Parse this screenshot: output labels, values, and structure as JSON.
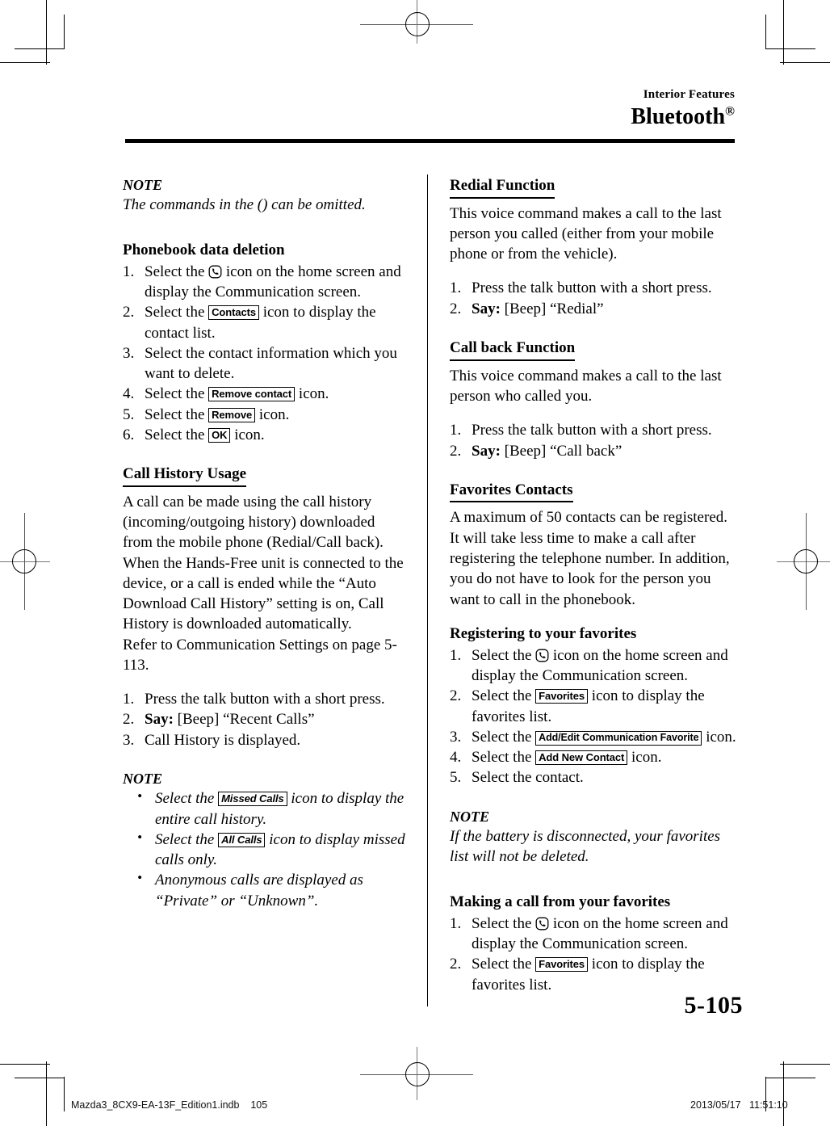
{
  "header": {
    "kicker": "Interior Features",
    "title": "Bluetooth",
    "registered_mark": "®"
  },
  "page_number": "5-105",
  "footer": {
    "file": "Mazda3_8CX9-EA-13F_Edition1.indb    105",
    "timestamp": "2013/05/17   11:51:10"
  },
  "icons": {
    "communication": "phone-communication-icon"
  },
  "left_column": {
    "note_1": {
      "label": "NOTE",
      "text": "The commands in the () can be omitted."
    },
    "phonebook_deletion": {
      "heading": "Phonebook data deletion",
      "steps": [
        {
          "num": "1.",
          "pre": "Select the ",
          "icon": "communication",
          "post": " icon on the home screen and display the Communication screen."
        },
        {
          "num": "2.",
          "pre": "Select the ",
          "button": "Contacts",
          "post": " icon to display the contact list."
        },
        {
          "num": "3.",
          "pre": "Select the contact information which you want to delete.",
          "post": ""
        },
        {
          "num": "4.",
          "pre": "Select the ",
          "button": "Remove contact",
          "post": " icon."
        },
        {
          "num": "5.",
          "pre": "Select the ",
          "button": "Remove",
          "post": " icon."
        },
        {
          "num": "6.",
          "pre": "Select the ",
          "button": "OK",
          "post": " icon."
        }
      ]
    },
    "call_history": {
      "heading": "Call History Usage",
      "paragraph": "A call can be made using the call history (incoming/outgoing history) downloaded from the mobile phone (Redial/Call back). When the Hands-Free unit is connected to the device, or a call is ended while the “Auto Download Call History” setting is on, Call History is downloaded automatically.",
      "paragraph_2": "Refer to Communication Settings on page 5-113.",
      "steps": [
        {
          "num": "1.",
          "text": "Press the talk button with a short press."
        },
        {
          "num": "2.",
          "say": "Say:",
          "text": " [Beep] “Recent Calls”"
        },
        {
          "num": "3.",
          "text": "Call History is displayed."
        }
      ]
    },
    "note_2": {
      "label": "NOTE",
      "bullets": [
        {
          "pre": "Select the ",
          "button": "Missed Calls",
          "post": " icon to display the entire call history."
        },
        {
          "pre": "Select the ",
          "button": "All Calls",
          "post": " icon to display missed calls only."
        },
        {
          "pre": "Anonymous calls are displayed as “Private” or “Unknown”.",
          "post": ""
        }
      ]
    }
  },
  "right_column": {
    "redial": {
      "heading": "Redial Function",
      "paragraph": "This voice command makes a call to the last person you called (either from your mobile phone or from the vehicle).",
      "steps": [
        {
          "num": "1.",
          "text": "Press the talk button with a short press."
        },
        {
          "num": "2.",
          "say": "Say:",
          "text": " [Beep] “Redial”"
        }
      ]
    },
    "call_back": {
      "heading": "Call back Function",
      "paragraph": "This voice command makes a call to the last person who called you.",
      "steps": [
        {
          "num": "1.",
          "text": "Press the talk button with a short press."
        },
        {
          "num": "2.",
          "say": "Say:",
          "text": " [Beep] “Call back”"
        }
      ]
    },
    "favorites_contacts": {
      "heading": "Favorites Contacts",
      "paragraph": "A maximum of 50 contacts can be registered. It will take less time to make a call after registering the telephone number. In addition, you do not have to look for the person you want to call in the phonebook."
    },
    "registering": {
      "heading": "Registering to your favorites",
      "steps": [
        {
          "num": "1.",
          "pre": "Select the ",
          "icon": "communication",
          "post": " icon on the home screen and display the Communication screen."
        },
        {
          "num": "2.",
          "pre": "Select the ",
          "button": "Favorites",
          "post": " icon to display the favorites list."
        },
        {
          "num": "3.",
          "pre": "Select the ",
          "button": "Add/Edit Communication Favorite",
          "post": " icon."
        },
        {
          "num": "4.",
          "pre": "Select the ",
          "button": "Add New Contact",
          "post": " icon."
        },
        {
          "num": "5.",
          "pre": "Select the contact.",
          "post": ""
        }
      ]
    },
    "note_3": {
      "label": "NOTE",
      "text": "If the battery is disconnected, your favorites list will not be deleted."
    },
    "making_call": {
      "heading": "Making a call from your favorites",
      "steps": [
        {
          "num": "1.",
          "pre": "Select the ",
          "icon": "communication",
          "post": " icon on the home screen and display the Communication screen."
        },
        {
          "num": "2.",
          "pre": "Select the ",
          "button": "Favorites",
          "post": " icon to display the favorites list."
        }
      ]
    }
  }
}
